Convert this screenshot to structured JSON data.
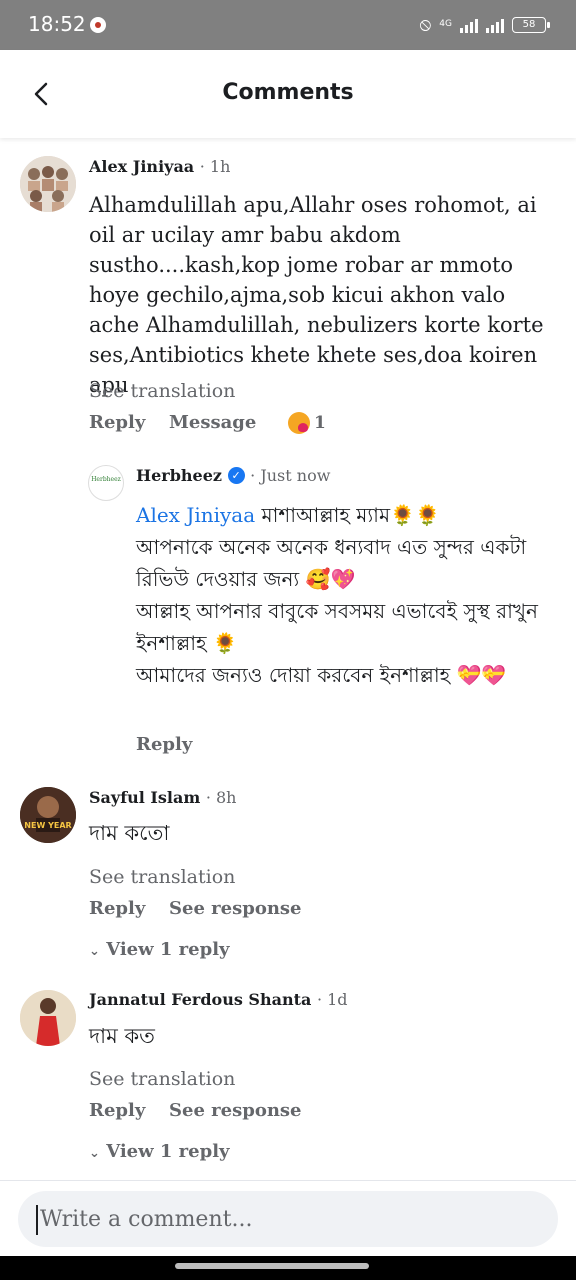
{
  "status_bar": {
    "time": "18:52",
    "network": "4G",
    "battery": "58"
  },
  "header": {
    "title": "Comments"
  },
  "comments": [
    {
      "author": "Alex Jiniyaa",
      "time": "· 1h",
      "text": "Alhamdulillah apu,Allahr oses rohomot, ai oil ar ucilay amr babu akdom sustho....kash,kop jome robar ar mmoto hoye gechilo,ajma,sob kicui akhon valo ache Alhamdulillah, nebulizers korte korte ses,Antibiotics khete khete ses,doa koiren apu",
      "see_translation": "See translation",
      "reply": "Reply",
      "message": "Message",
      "reaction_count": "1",
      "reply_thread": {
        "author": "Herbheez",
        "avatar_text": "Herbheez",
        "time": "· Just now",
        "mention": "Alex Jiniyaa",
        "line1": "মাশাআল্লাহ ম্যাম🌻🌻",
        "line2": "আপনাকে অনেক অনেক ধন্যবাদ এত সুন্দর একটা রিভিউ দেওয়ার জন্য 🥰💖",
        "line3": "আল্লাহ আপনার বাবুকে সবসময় এভাবেই সুস্থ রাখুন ইনশাল্লাহ 🌻",
        "line4": "আমাদের জন্যও দোয়া করবেন ইনশাল্লাহ 💝💝",
        "reply": "Reply"
      }
    },
    {
      "author": "Sayful Islam",
      "time": "· 8h",
      "avatar_text": "NEW YEAR",
      "text": "দাম কতো",
      "see_translation": "See translation",
      "reply": "Reply",
      "see_response": "See response",
      "view_replies": "View 1 reply"
    },
    {
      "author": "Jannatul Ferdous Shanta",
      "time": "· 1d",
      "text": "দাম কত",
      "see_translation": "See translation",
      "reply": "Reply",
      "see_response": "See response",
      "view_replies": "View 1 reply"
    }
  ],
  "composer": {
    "placeholder": "Write a comment..."
  }
}
